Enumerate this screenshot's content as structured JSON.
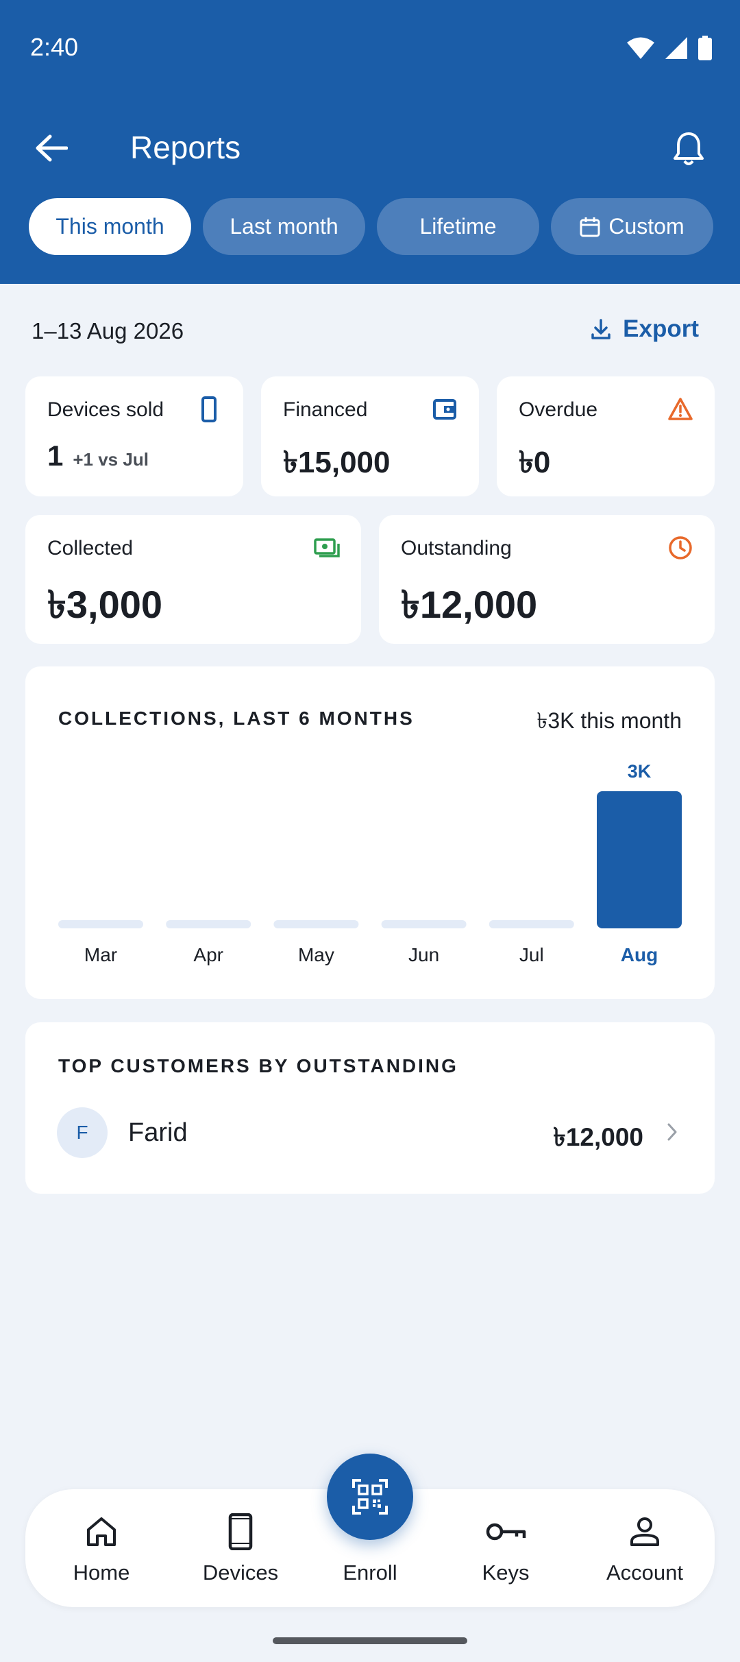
{
  "status_bar": {
    "time": "2:40"
  },
  "appbar": {
    "title": "Reports"
  },
  "tabs": [
    {
      "label": "This month",
      "active": true
    },
    {
      "label": "Last month",
      "active": false
    },
    {
      "label": "Lifetime",
      "active": false
    },
    {
      "label": "Custom",
      "active": false,
      "icon": "calendar-icon"
    }
  ],
  "range": {
    "label": "1–13 Aug 2026",
    "export_label": "Export"
  },
  "stats": {
    "devices_sold": {
      "label": "Devices sold",
      "value": "1",
      "note": "+1 vs Jul",
      "icon": "phone-icon"
    },
    "financed": {
      "label": "Financed",
      "value": "৳15,000",
      "icon": "wallet-icon"
    },
    "overdue": {
      "label": "Overdue",
      "value": "৳0",
      "icon": "warning-icon"
    },
    "collected": {
      "label": "Collected",
      "value": "৳3,000",
      "icon": "cash-icon"
    },
    "outstanding": {
      "label": "Outstanding",
      "value": "৳12,000",
      "icon": "clock-icon"
    }
  },
  "colors": {
    "primary": "#1b5da8",
    "background": "#eff3f9",
    "track": "#e3ebf7",
    "success": "#2e9e4f",
    "warning": "#e8692b"
  },
  "chart_section": {
    "title": "COLLECTIONS, LAST 6 MONTHS",
    "summary": "৳3K this month"
  },
  "chart_data": {
    "type": "bar",
    "categories": [
      "Mar",
      "Apr",
      "May",
      "Jun",
      "Jul",
      "Aug"
    ],
    "values": [
      0,
      0,
      0,
      0,
      0,
      3000
    ],
    "data_labels": [
      "",
      "",
      "",
      "",
      "",
      "3K"
    ],
    "highlight": "Aug",
    "ylim": [
      0,
      3000
    ],
    "grid": false
  },
  "top_customers": {
    "title": "TOP CUSTOMERS BY OUTSTANDING",
    "items": [
      {
        "initial": "F",
        "name": "Farid",
        "amount": "৳12,000"
      }
    ]
  },
  "nav": {
    "items": [
      {
        "label": "Home",
        "icon": "home-icon"
      },
      {
        "label": "Devices",
        "icon": "phone-icon"
      },
      {
        "label": "Enroll",
        "icon": "qr-code-icon"
      },
      {
        "label": "Keys",
        "icon": "key-icon"
      },
      {
        "label": "Account",
        "icon": "person-icon"
      }
    ]
  }
}
